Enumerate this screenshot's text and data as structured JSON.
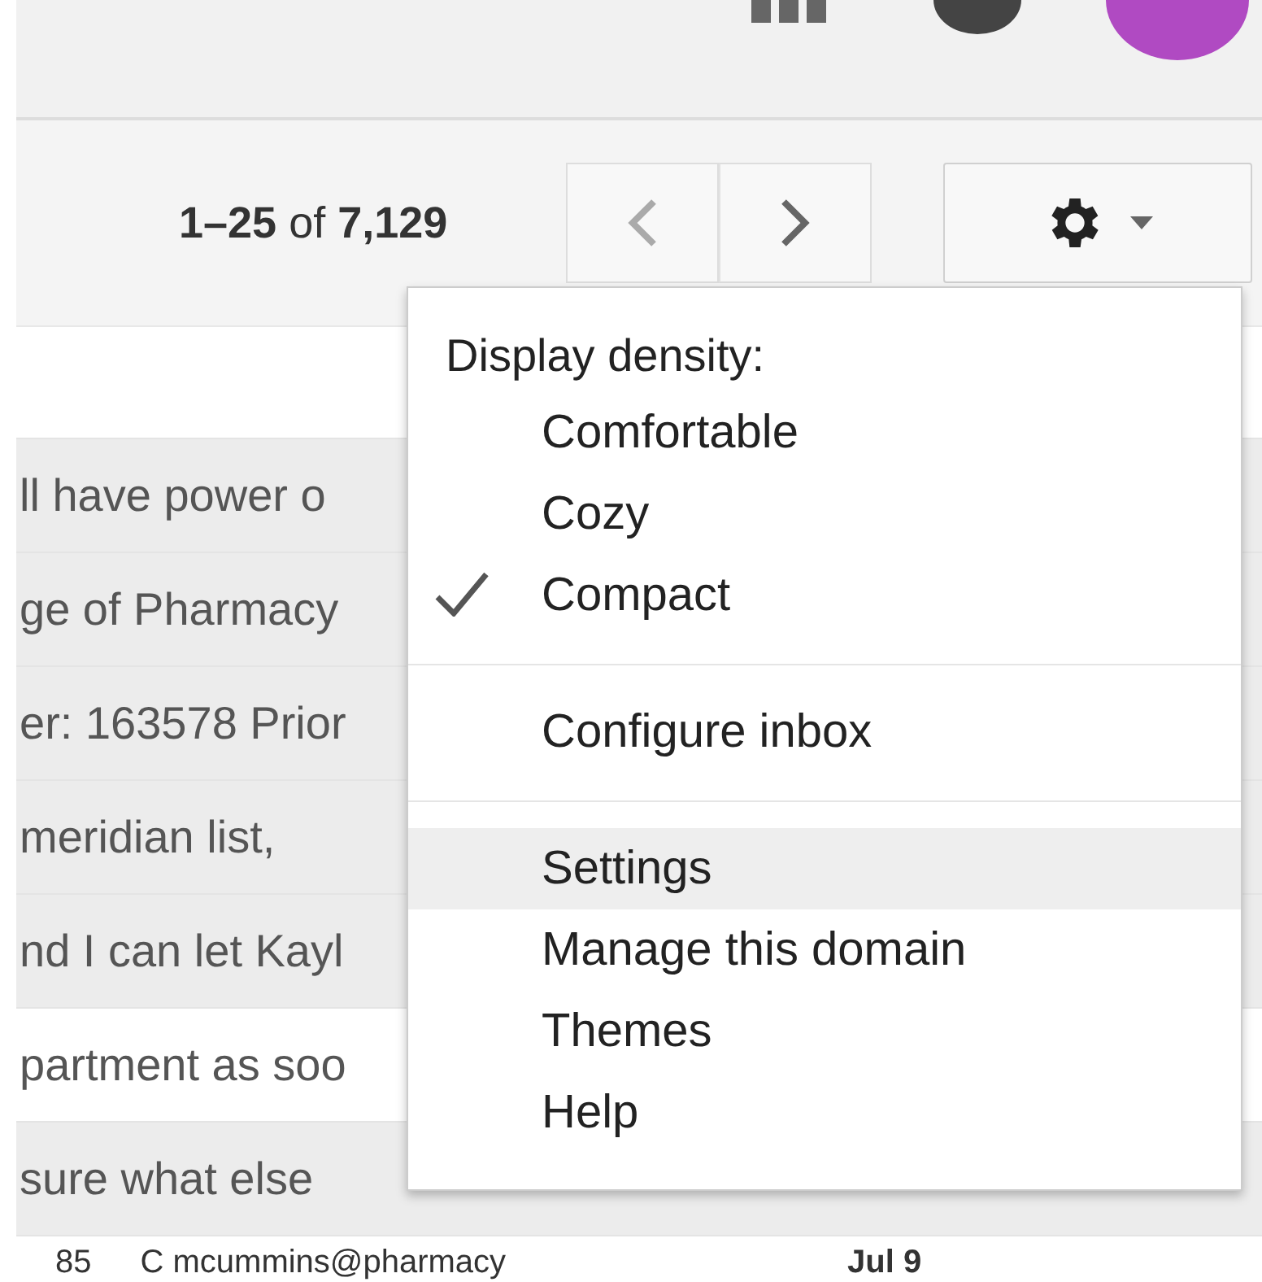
{
  "pagination": {
    "text": "**1–25** of **7,129**"
  },
  "rows": [
    {
      "kind": "snippet",
      "read": true,
      "snippet": "ll have power o"
    },
    {
      "kind": "snippet",
      "read": true,
      "snippet": "ge of Pharmacy"
    },
    {
      "kind": "snippet",
      "read": true,
      "snippet": "er: 163578 Prior"
    },
    {
      "kind": "snippet",
      "read": true,
      "snippet": "meridian list,"
    },
    {
      "kind": "snippet",
      "read": true,
      "snippet": "nd I can let Kayl"
    },
    {
      "kind": "snippet",
      "read": false,
      "snippet": "partment as soo"
    },
    {
      "kind": "snippet",
      "read": true,
      "snippet": "sure what else"
    },
    {
      "kind": "message",
      "read": false,
      "count": "85",
      "sender": "C mcummins@pharmacy",
      "date": "Jul 9"
    }
  ],
  "menu": {
    "heading": "Display density:",
    "density_options": [
      {
        "label": "Comfortable",
        "checked": false
      },
      {
        "label": "Cozy",
        "checked": false
      },
      {
        "label": "Compact",
        "checked": true
      }
    ],
    "sections": [
      {
        "items": [
          {
            "label": "Configure inbox",
            "highlighted": false
          }
        ]
      },
      {
        "items": [
          {
            "label": "Settings",
            "highlighted": true
          },
          {
            "label": "Manage this domain",
            "highlighted": false
          },
          {
            "label": "Themes",
            "highlighted": false
          },
          {
            "label": "Help",
            "highlighted": false
          }
        ]
      }
    ]
  }
}
